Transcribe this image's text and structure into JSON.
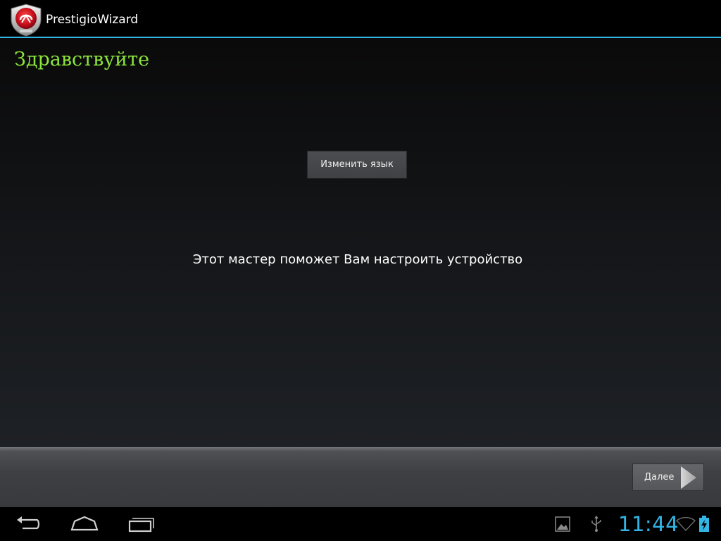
{
  "action_bar": {
    "title": "PrestigioWizard",
    "app_icon": "prestigio-shield-icon"
  },
  "content": {
    "greeting": "Здравствуйте",
    "change_language_label": "Изменить язык",
    "wizard_description": "Этот мастер поможет Вам настроить устройство"
  },
  "bottom_panel": {
    "next_label": "Далее",
    "next_icon": "arrow-right-icon"
  },
  "system_bar": {
    "nav": [
      "back-icon",
      "home-icon",
      "recent-apps-icon"
    ],
    "status_icons": [
      "gallery-notification-icon",
      "usb-icon",
      "wifi-icon",
      "battery-charging-icon"
    ],
    "clock": "11:44"
  },
  "colors": {
    "accent": "#33b5e5",
    "greeting": "#8ce53c",
    "background": "#000000"
  }
}
